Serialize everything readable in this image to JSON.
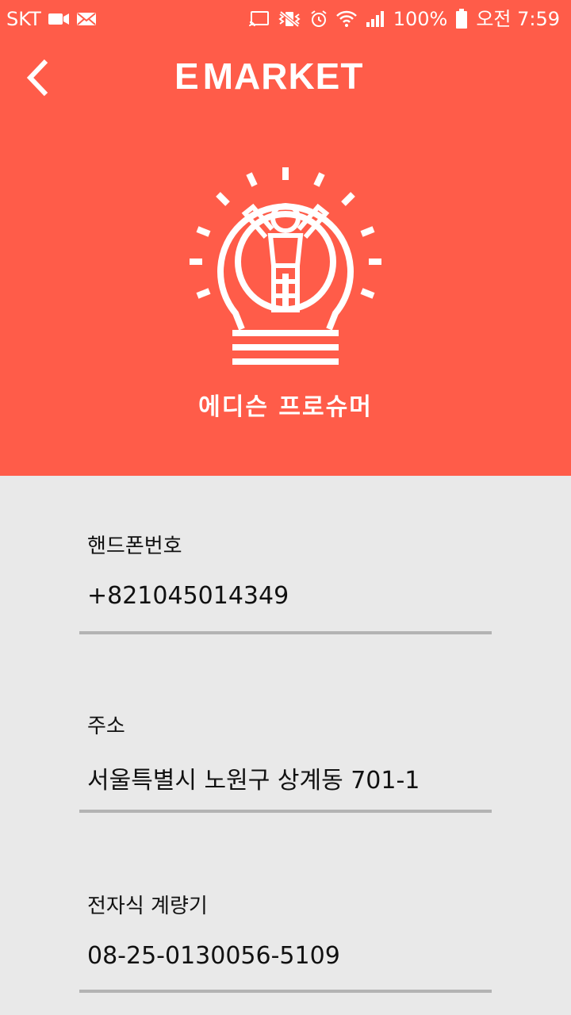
{
  "status_bar": {
    "carrier": "SKT",
    "battery_percent": "100%",
    "time": "오전 7:59"
  },
  "app_bar": {
    "logo_mark": "E",
    "logo_text": "MARKET"
  },
  "profile": {
    "name": "에디슨 프로슈머"
  },
  "fields": [
    {
      "label": "핸드폰번호",
      "value": "+821045014349"
    },
    {
      "label": "주소",
      "value": "서울특별시 노원구 상계동 701-1"
    },
    {
      "label": "전자식 계량기",
      "value": "08-25-0130056-5109"
    }
  ],
  "colors": {
    "header_bg": "#ff5c49",
    "body_bg": "#e9e9e9",
    "divider": "#b3b3b3"
  }
}
